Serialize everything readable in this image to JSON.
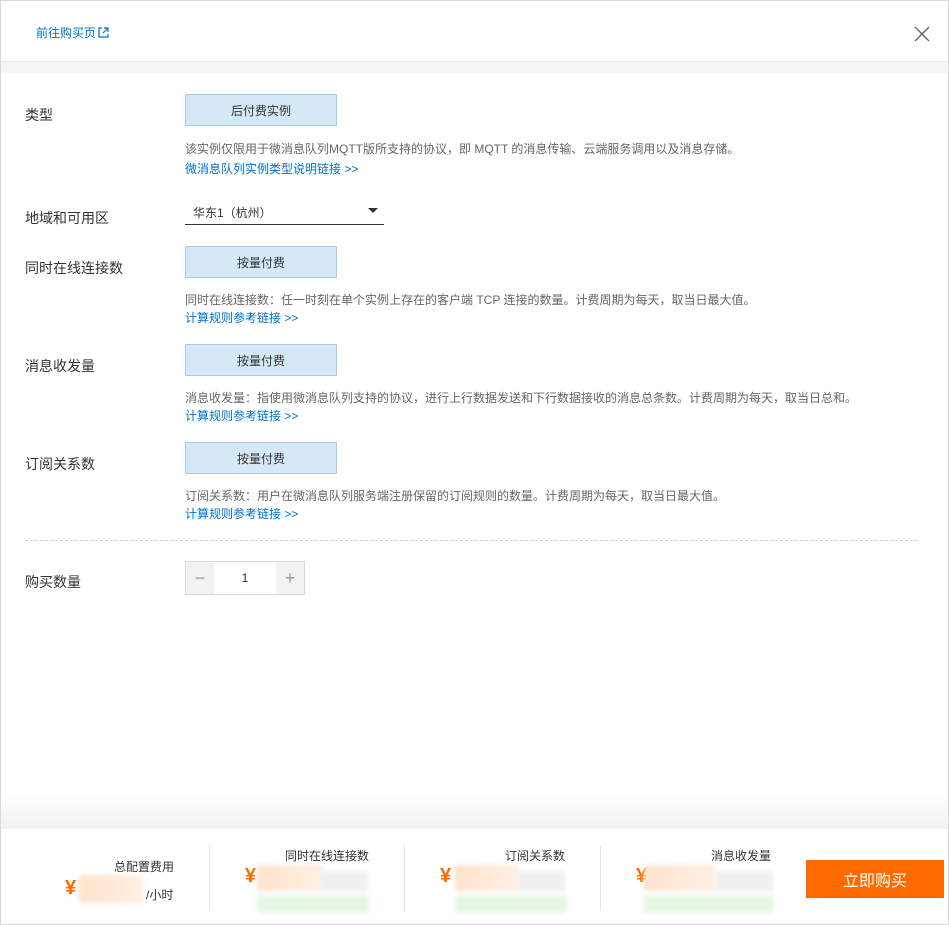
{
  "header": {
    "buy_page_link": "前往购买页"
  },
  "form": {
    "type": {
      "label": "类型",
      "option": "后付费实例",
      "description": "该实例仅限用于微消息队列MQTT版所支持的协议，即 MQTT 的消息传输、云端服务调用以及消息存储。",
      "link": "微消息队列实例类型说明链接 >>"
    },
    "region": {
      "label": "地域和可用区",
      "value": "华东1（杭州）"
    },
    "connections": {
      "label": "同时在线连接数",
      "option": "按量付费",
      "description": "同时在线连接数：任一时刻在单个实例上存在的客户端 TCP 连接的数量。计费周期为每天，取当日最大值。",
      "link": "计算规则参考链接 >>"
    },
    "messages": {
      "label": "消息收发量",
      "option": "按量付费",
      "description": "消息收发量：指使用微消息队列支持的协议，进行上行数据发送和下行数据接收的消息总条数。计费周期为每天，取当日总和。",
      "link": "计算规则参考链接 >>"
    },
    "subscriptions": {
      "label": "订阅关系数",
      "option": "按量付费",
      "description": "订阅关系数：用户在微消息队列服务端注册保留的订阅规则的数量。计费周期为每天，取当日最大值。",
      "link": "计算规则参考链接 >>"
    },
    "quantity": {
      "label": "购买数量",
      "value": "1",
      "minus": "−",
      "plus": "+"
    }
  },
  "footer": {
    "total": {
      "title": "总配置费用",
      "currency": "¥",
      "unit": "/小时"
    },
    "connections": {
      "title": "同时在线连接数",
      "currency": "¥"
    },
    "subscriptions": {
      "title": "订阅关系数",
      "currency": "¥"
    },
    "messages": {
      "title": "消息收发量",
      "currency": "¥"
    },
    "buy_button": "立即购买"
  },
  "colors": {
    "accent": "#ff6a00",
    "link": "#0070cc",
    "chip_bg": "#d5e8f5"
  }
}
